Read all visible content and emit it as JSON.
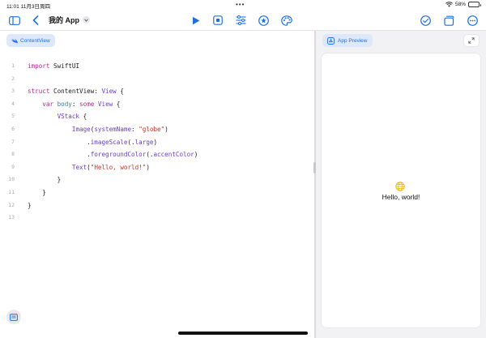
{
  "status_bar": {
    "time": "11:01",
    "date": "11月3日周四",
    "battery": "58%",
    "battery_level": 0.58
  },
  "toolbar": {
    "project_title": "我的 App",
    "icons": [
      "sidebar-toggle-icon",
      "back-chevron-icon",
      "dropdown-chevron-icon",
      "run-icon",
      "stop-icon",
      "sliders-icon",
      "star-icon",
      "palette-icon",
      "checkmark-circle-icon",
      "copy-icon",
      "more-icon"
    ]
  },
  "colors": {
    "accent": "#1f6fe0",
    "keyword": "#b3268f",
    "type": "#6a3fc1",
    "string": "#c8322a",
    "method": "#3f7fa4",
    "globe": "#f2b705"
  },
  "editor": {
    "tab_label": "ContentView",
    "lines": [
      {
        "n": "1",
        "parts": [
          {
            "t": "import",
            "c": "kw"
          },
          {
            "t": " SwiftUI",
            "c": ""
          }
        ]
      },
      {
        "n": "2",
        "parts": []
      },
      {
        "n": "3",
        "parts": [
          {
            "t": "struct",
            "c": "kw"
          },
          {
            "t": " ContentView",
            "c": ""
          },
          {
            "t": ": ",
            "c": ""
          },
          {
            "t": "View",
            "c": "ty"
          },
          {
            "t": " {",
            "c": ""
          }
        ]
      },
      {
        "n": "4",
        "parts": [
          {
            "t": "    ",
            "c": ""
          },
          {
            "t": "var",
            "c": "kw"
          },
          {
            "t": " ",
            "c": ""
          },
          {
            "t": "body",
            "c": "fn"
          },
          {
            "t": ": ",
            "c": ""
          },
          {
            "t": "some",
            "c": "kw"
          },
          {
            "t": " ",
            "c": ""
          },
          {
            "t": "View",
            "c": "ty"
          },
          {
            "t": " {",
            "c": ""
          }
        ]
      },
      {
        "n": "5",
        "parts": [
          {
            "t": "        ",
            "c": ""
          },
          {
            "t": "VStack",
            "c": "ty"
          },
          {
            "t": " {",
            "c": ""
          }
        ]
      },
      {
        "n": "6",
        "parts": [
          {
            "t": "            ",
            "c": ""
          },
          {
            "t": "Image",
            "c": "ty"
          },
          {
            "t": "(",
            "c": ""
          },
          {
            "t": "systemName",
            "c": "ty"
          },
          {
            "t": ": ",
            "c": ""
          },
          {
            "t": "\"globe\"",
            "c": "str"
          },
          {
            "t": ")",
            "c": ""
          }
        ]
      },
      {
        "n": "7",
        "parts": [
          {
            "t": "                .",
            "c": ""
          },
          {
            "t": "imageScale",
            "c": "ty"
          },
          {
            "t": "(.",
            "c": ""
          },
          {
            "t": "large",
            "c": "ty"
          },
          {
            "t": ")",
            "c": ""
          }
        ]
      },
      {
        "n": "8",
        "parts": [
          {
            "t": "                .",
            "c": ""
          },
          {
            "t": "foregroundColor",
            "c": "ty"
          },
          {
            "t": "(.",
            "c": ""
          },
          {
            "t": "accentColor",
            "c": "ty"
          },
          {
            "t": ")",
            "c": ""
          }
        ]
      },
      {
        "n": "9",
        "parts": [
          {
            "t": "            ",
            "c": ""
          },
          {
            "t": "Text",
            "c": "ty"
          },
          {
            "t": "(",
            "c": ""
          },
          {
            "t": "\"Hello, world!\"",
            "c": "str"
          },
          {
            "t": ")",
            "c": ""
          }
        ]
      },
      {
        "n": "10",
        "parts": [
          {
            "t": "        }",
            "c": ""
          }
        ]
      },
      {
        "n": "11",
        "parts": [
          {
            "t": "    }",
            "c": ""
          }
        ]
      },
      {
        "n": "12",
        "parts": [
          {
            "t": "}",
            "c": ""
          }
        ]
      },
      {
        "n": "13",
        "parts": []
      }
    ]
  },
  "preview": {
    "tab_label": "App Preview",
    "hello_text": "Hello, world!"
  }
}
